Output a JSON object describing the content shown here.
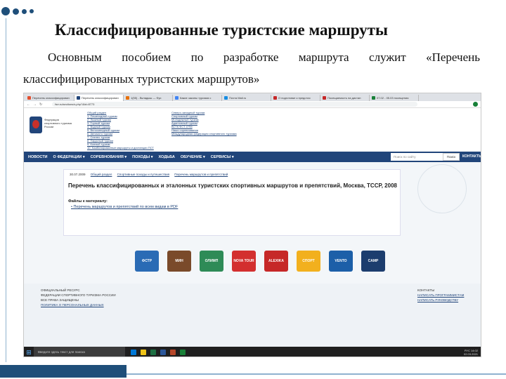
{
  "slide": {
    "title": "Классифицированные туристские маршруты",
    "paragraph_line1": "Основным пособием по разработке маршрута служит «Перечень",
    "paragraph_line2": "классифицированных туристских маршрутов»"
  },
  "browser": {
    "tabs": [
      {
        "label": "Перечень классифицирован",
        "color": "#e34f2f"
      },
      {
        "label": "Перечень классифицирован",
        "color": "#21457a"
      },
      {
        "label": "1(55) - Вкладыш — Фус",
        "color": "#e8710a"
      },
      {
        "label": "Какие законы туризма с",
        "color": "#4285f4"
      },
      {
        "label": "Почта Mail.ru",
        "color": "#168de2"
      },
      {
        "label": "О подготовке к предстоя",
        "color": "#c62828"
      },
      {
        "label": "Посещаемость на дистан",
        "color": "#c62828"
      },
      {
        "label": "07.02 - 05.03 посещения",
        "color": "#188038"
      }
    ],
    "url": "fsrr.ru/sections/s.php?&id=8773"
  },
  "site": {
    "org_name": "Федерация спортивного туризма России",
    "menu_col1": [
      "Общий раздел",
      "1. Пешеходный туризм",
      "2. Лыжный туризм",
      "3. Горный туризм",
      "4. Водный туризм",
      "5. Велосипедный туризм",
      "6. Автомото туризм",
      "7. Спелео туризм",
      "8. Парусный туризм",
      "9. Конный туризм",
      "10. Комбинированные маршруты и дистанции ПСТ"
    ],
    "menu_col2": [
      "Северо-западный туризм",
      "Спортивный туризм",
      "Молодежный туризм",
      "Адаптивный туризм",
      "ВСТК ФСТ-ОТМ",
      "Наши соревнования",
      "Международная федерация спортивного туризма"
    ],
    "nav": [
      "НОВОСТИ",
      "О ФЕДЕРАЦИИ ▾",
      "СОРЕВНОВАНИЯ ▾",
      "ПОХОДЫ ▾",
      "ХОДЬБА",
      "ОБУЧЕНИЕ ▾",
      "СЕРВИСЫ ▾"
    ],
    "search_placeholder": "Поиск по сайту",
    "search_button": "Поиск",
    "contacts": "КОНТАКТЫ",
    "crumbs_date": "30.07.2009",
    "crumbs": [
      "Общий раздел",
      "Спортивные походы и путешествия",
      "Перечень маршрутов и препятствий"
    ],
    "doc_title": "Перечень классифицированных и эталонных туристских спортивных маршрутов и препятствий, Москва, ТССР, 2008",
    "files_label": "Файлы к материалу:",
    "file_link": "Перечень маршрутов и препятствий по всем видам в PDF",
    "partners": [
      {
        "label": "ФСТР",
        "color": "#2a6bb5"
      },
      {
        "label": "МИН",
        "color": "#7a4a2a"
      },
      {
        "label": "ОЛИМП",
        "color": "#2e8b57"
      },
      {
        "label": "NOVA TOUR",
        "color": "#d32f2f"
      },
      {
        "label": "ALEXIKA",
        "color": "#c62828"
      },
      {
        "label": "СПОРТ",
        "color": "#f2b01e"
      },
      {
        "label": "VENTO",
        "color": "#1c5fa8"
      },
      {
        "label": "CAMP",
        "color": "#1c3d6e"
      }
    ],
    "footer_left": [
      "ОФИЦИАЛЬНЫЙ РЕСУРС",
      "ФЕДЕРАЦИИ СПОРТИВНОГО ТУРИЗМА РОССИИ",
      "ВСЕ ПРАВА ЗАЩИЩЕНЫ",
      "ПОЛИТИКА О ПЕРСОНАЛЬНЫХ ДАННЫХ"
    ],
    "footer_right": [
      "КОНТАКТЫ",
      "НАПИСАТЬ ПРОГРАММИСТАМ",
      "НАПИСАТЬ РУКОВОДСТВУ"
    ]
  },
  "taskbar": {
    "search_placeholder": "Введите здесь текст для поиска",
    "time": "14:02",
    "date": "02.03.2021",
    "lang": "РУС"
  }
}
